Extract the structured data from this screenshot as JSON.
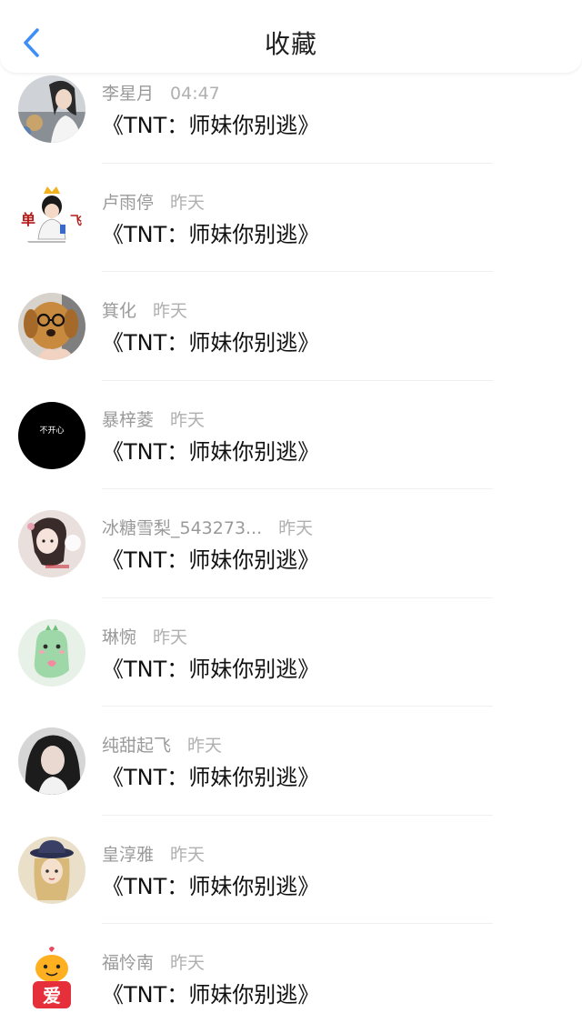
{
  "header": {
    "title": "收藏",
    "back_icon": "chevron-left-icon",
    "accent_color": "#3d8ef7"
  },
  "items": [
    {
      "name": "李星月",
      "time": "04:47",
      "text": "《TNT：师妹你别逃》",
      "avatar": "photo-girl-avatar"
    },
    {
      "name": "卢雨停",
      "time": "昨天",
      "text": "《TNT：师妹你别逃》",
      "avatar": "crown-boy-avatar",
      "avatar_text": [
        "单",
        "飞"
      ]
    },
    {
      "name": "箕化",
      "time": "昨天",
      "text": "《TNT：师妹你别逃》",
      "avatar": "dog-avatar"
    },
    {
      "name": "暴梓菱",
      "time": "昨天",
      "text": "《TNT：师妹你别逃》",
      "avatar": "black-text-avatar",
      "avatar_text": "不开心"
    },
    {
      "name": "冰糖雪梨_543273...",
      "time": "昨天",
      "text": "《TNT：师妹你别逃》",
      "avatar": "illustration-girl-avatar"
    },
    {
      "name": "琳惋",
      "time": "昨天",
      "text": "《TNT：师妹你别逃》",
      "avatar": "green-dino-avatar"
    },
    {
      "name": "纯甜起飞",
      "time": "昨天",
      "text": "《TNT：师妹你别逃》",
      "avatar": "photo-woman-avatar"
    },
    {
      "name": "皇淳雅",
      "time": "昨天",
      "text": "《TNT：师妹你别逃》",
      "avatar": "hat-girl-avatar"
    },
    {
      "name": "福怜南",
      "time": "昨天",
      "text": "《TNT：师妹你别逃》",
      "avatar": "love-cartoon-avatar",
      "avatar_text": "爱"
    }
  ]
}
